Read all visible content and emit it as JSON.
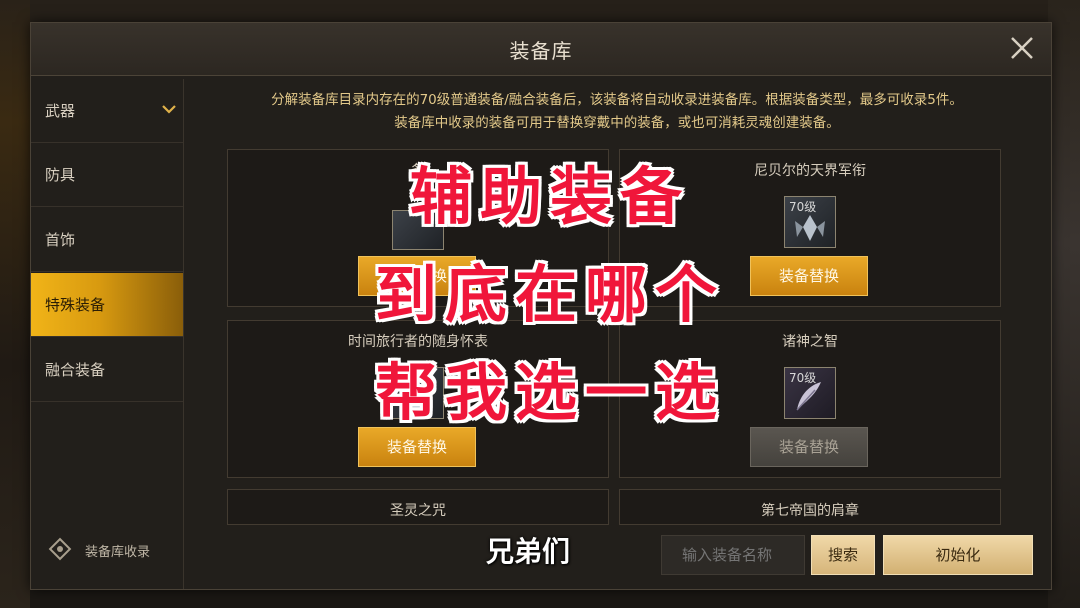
{
  "dialog": {
    "title": "装备库",
    "description_line1": "分解装备库目录内存在的70级普通装备/融合装备后，该装备将自动收录进装备库。根据装备类型，最多可收录5件。",
    "description_line2": "装备库中收录的装备可用于替换穿戴中的装备，或也可消耗灵魂创建装备。"
  },
  "sidebar": {
    "items": [
      {
        "label": "武器"
      },
      {
        "label": "防具"
      },
      {
        "label": "首饰"
      },
      {
        "label": "特殊装备"
      },
      {
        "label": "融合装备"
      }
    ],
    "footer_label": "装备库收录"
  },
  "cards": [
    {
      "name": "备",
      "level": "",
      "button": "装备替换"
    },
    {
      "name": "尼贝尔的天界军衔",
      "level": "70级",
      "button": "装备替换"
    },
    {
      "name": "时间旅行者的随身怀表",
      "level": "级",
      "button": "装备替换"
    },
    {
      "name": "诸神之智",
      "level": "70级",
      "button": "装备替换"
    },
    {
      "name": "圣灵之咒"
    },
    {
      "name": "第七帝国的肩章"
    }
  ],
  "bottom": {
    "search_placeholder": "输入装备名称",
    "search_button": "搜索",
    "reset_button": "初始化"
  },
  "overlay_text": {
    "line1": "辅助装备",
    "line2": "到底在哪个",
    "line3": "帮我选一选"
  },
  "subtitle": "兄弟们",
  "colors": {
    "accent_gold": "#e9a928",
    "overlay_red": "#f0163a",
    "description_text": "#e3c98a"
  }
}
